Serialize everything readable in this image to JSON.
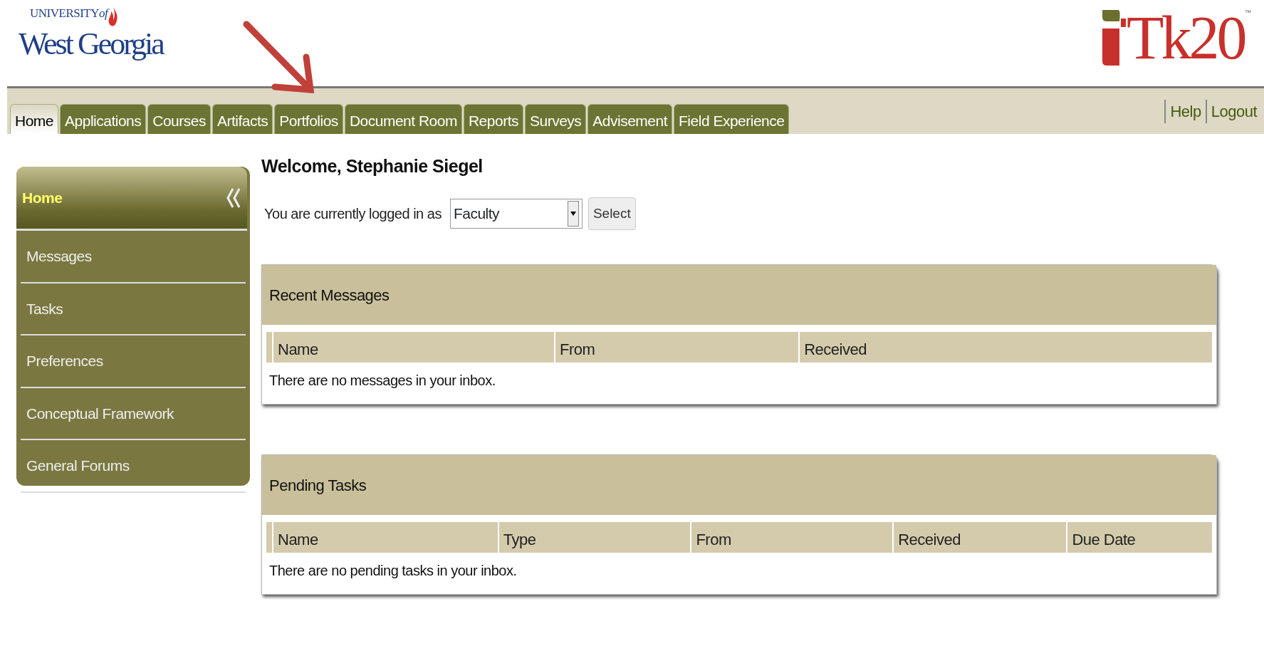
{
  "logo": {
    "top": "UNIVERSITY",
    "top_suffix": "of",
    "name": "West Georgia"
  },
  "brand": {
    "name": "Tk20",
    "mark": "™"
  },
  "tabs": [
    {
      "label": "Home",
      "selected": true
    },
    {
      "label": "Applications",
      "selected": false
    },
    {
      "label": "Courses",
      "selected": false
    },
    {
      "label": "Artifacts",
      "selected": false
    },
    {
      "label": "Portfolios",
      "selected": false
    },
    {
      "label": "Document Room",
      "selected": false
    },
    {
      "label": "Reports",
      "selected": false
    },
    {
      "label": "Surveys",
      "selected": false
    },
    {
      "label": "Advisement",
      "selected": false
    },
    {
      "label": "Field Experience",
      "selected": false
    }
  ],
  "links": [
    "Help",
    "Logout"
  ],
  "sidebar": {
    "title": "Home",
    "items": [
      "Messages",
      "Tasks",
      "Preferences",
      "Conceptual Framework",
      "General Forums"
    ]
  },
  "welcome": "Welcome, Stephanie Siegel",
  "role": {
    "label": "You are currently logged in as",
    "value": "Faculty",
    "button": "Select"
  },
  "panels": [
    {
      "title": "Recent Messages",
      "columns": [
        "Name",
        "From",
        "Received"
      ],
      "empty": "There are no messages in your inbox."
    },
    {
      "title": "Pending Tasks",
      "columns": [
        "Name",
        "Type",
        "From",
        "Received",
        "Due Date"
      ],
      "empty": "There are no pending tasks in your inbox."
    }
  ]
}
